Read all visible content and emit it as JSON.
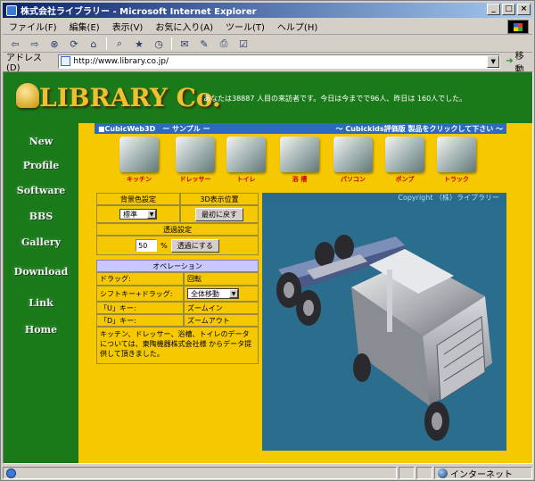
{
  "window": {
    "title": "株式会社ライブラリー - Microsoft Internet Explorer",
    "min": "_",
    "max": "□",
    "close": "×"
  },
  "menu": [
    "ファイル(F)",
    "編集(E)",
    "表示(V)",
    "お気に入り(A)",
    "ツール(T)",
    "ヘルプ(H)"
  ],
  "address": {
    "label": "アドレス(D)",
    "url": "http://www.library.co.jp/",
    "go": "移動"
  },
  "status": {
    "zone": "インターネット"
  },
  "site": {
    "logo": "LIBRARY Co.",
    "visitor": "あなたは38887 人目の来訪者です。今日は今までで96人、昨日は 160人でした。",
    "nav": [
      "New",
      "Profile",
      "Software",
      "BBS",
      "Gallery",
      "Download",
      "Link",
      "Home"
    ]
  },
  "bar": {
    "left": "■CubicWeb3D　ー サンプル ー",
    "right": "～ Cubickids評価版 製品をクリックして下さい ～"
  },
  "products": [
    "キッチン",
    "ドレッサー",
    "トイレ",
    "浴 槽",
    "パソコン",
    "ポンプ",
    "トラック"
  ],
  "panel": {
    "bg_header": "背景色設定",
    "view_header": "3D表示位置",
    "bg_value": "標準",
    "reset_button": "最初に戻す",
    "transparency_header": "透過設定",
    "transparency_value": "50",
    "percent": "%",
    "transparent_button": "透過にする",
    "operation_header": "オペレーション",
    "rows": [
      {
        "key": "ドラッグ:",
        "value": "回転"
      },
      {
        "key": "シフトキー+ドラッグ:",
        "value": "全体移動"
      },
      {
        "key": "「U」キー:",
        "value": "ズームイン"
      },
      {
        "key": "「D」キー:",
        "value": "ズームアウト"
      }
    ],
    "note": "キッチン、ドレッサー、浴槽、トイレのデータについては、東陶機器株式会社様 からデータ提供して頂きました。"
  },
  "viewer": {
    "copyright": "Copyright （株）ライブラリー"
  },
  "colors": {
    "green": "#1a7a1a",
    "yellow": "#f5c800",
    "blue_bar": "#2a6abf",
    "viewer_bg": "#2b6d8c"
  }
}
